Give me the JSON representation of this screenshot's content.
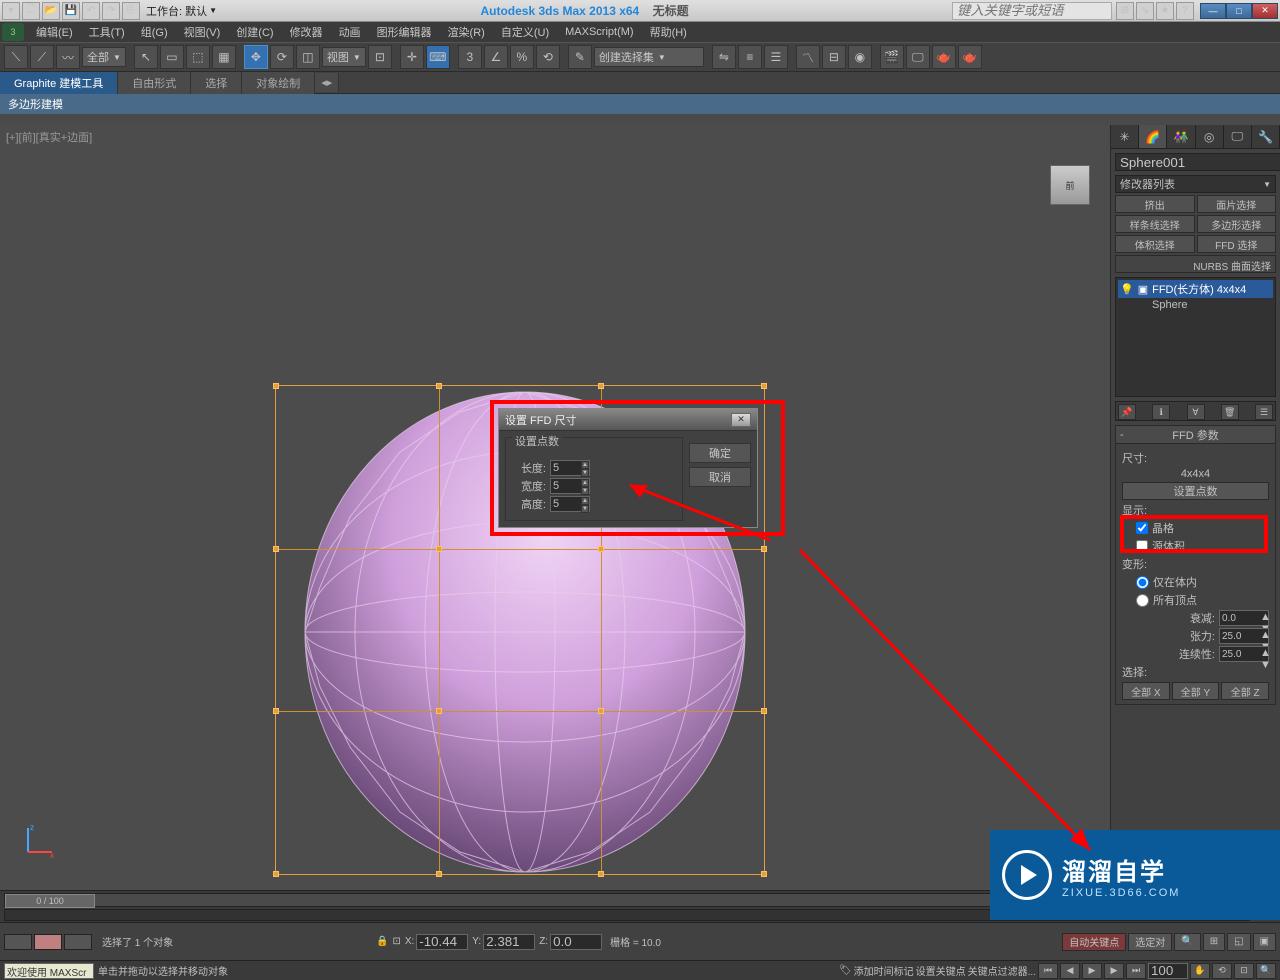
{
  "titlebar": {
    "workspace_label": "工作台: 默认",
    "app_title": "Autodesk 3ds Max  2013 x64",
    "untitled": "无标题",
    "search_placeholder": "键入关键字或短语"
  },
  "menus": [
    "编辑(E)",
    "工具(T)",
    "组(G)",
    "视图(V)",
    "创建(C)",
    "修改器",
    "动画",
    "图形编辑器",
    "渲染(R)",
    "自定义(U)",
    "MAXScript(M)",
    "帮助(H)"
  ],
  "toolbar": {
    "filter": "全部",
    "ref_system": "视图",
    "named_sel": "创建选择集"
  },
  "ribbon": {
    "tabs": [
      "Graphite 建模工具",
      "自由形式",
      "选择",
      "对象绘制"
    ],
    "sub": "多边形建模"
  },
  "viewport": {
    "label": "[+][前][真实+边面]",
    "viewcube": "前"
  },
  "dialog": {
    "title": "设置 FFD 尺寸",
    "group": "设置点数",
    "length_label": "长度:",
    "width_label": "宽度:",
    "height_label": "高度:",
    "length": "5",
    "width": "5",
    "height": "5",
    "ok": "确定",
    "cancel": "取消"
  },
  "panel": {
    "object_name": "Sphere001",
    "mod_list": "修改器列表",
    "sel_sets": [
      "挤出",
      "面片选择",
      "样条线选择",
      "多边形选择",
      "体积选择",
      "FFD 选择"
    ],
    "nurbs": "NURBS 曲面选择",
    "stack": {
      "ffd": "FFD(长方体) 4x4x4",
      "base": "Sphere"
    },
    "rollout_title": "FFD 参数",
    "size_label": "尺寸:",
    "size_value": "4x4x4",
    "set_points": "设置点数",
    "display_label": "显示:",
    "lattice": "晶格",
    "source_vol": "源体积",
    "deform_label": "变形:",
    "in_volume": "仅在体内",
    "all_verts": "所有顶点",
    "falloff_label": "衰减:",
    "falloff": "0.0",
    "tension_label": "张力:",
    "tension": "25.0",
    "continuity_label": "连续性:",
    "continuity": "25.0",
    "select_label": "选择:",
    "all_x": "全部 X",
    "all_y": "全部 Y",
    "all_z": "全部 Z"
  },
  "timeline": {
    "frame_display": "0 / 100"
  },
  "status": {
    "selected": "选择了 1 个对象",
    "grid": "栅格 = 10.0",
    "x": "-10.44",
    "y": "2.381",
    "z": "0.0",
    "auto_key": "自动关键点",
    "selected_obj": "选定对",
    "set_key": "设置关键点",
    "key_filters": "关键点过滤器..."
  },
  "status2": {
    "welcome": "欢迎使用  MAXScr",
    "tip": "单击并拖动以选择并移动对象",
    "add_time": "添加时间标记",
    "frame": "100"
  },
  "watermark": {
    "big": "溜溜自学",
    "small": "ZIXUE.3D66.COM"
  }
}
